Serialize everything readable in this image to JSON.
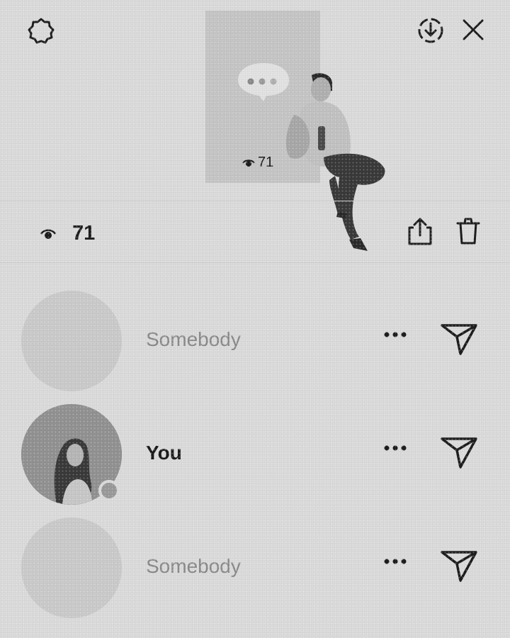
{
  "header": {
    "thumbnail_views": "71",
    "actions": [
      "settings-icon",
      "download-icon",
      "close-icon"
    ]
  },
  "views_bar": {
    "count": "71",
    "actions": [
      "share-icon",
      "trash-icon"
    ]
  },
  "viewers": [
    {
      "name": "Somebody",
      "has_photo": false
    },
    {
      "name": "You",
      "has_photo": true
    },
    {
      "name": "Somebody",
      "has_photo": false
    }
  ]
}
